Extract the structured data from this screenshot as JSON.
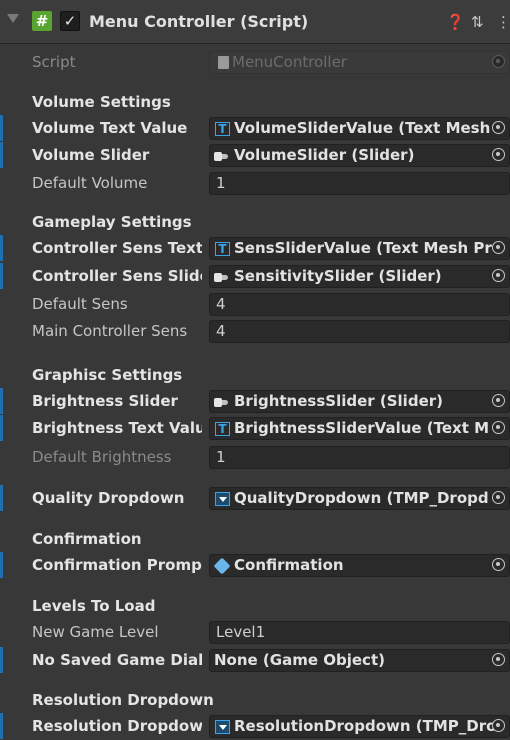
{
  "header": {
    "title": "Menu Controller (Script)",
    "script_icon": "#",
    "enabled_check": "✓",
    "help_icon": "❓",
    "preset_icon": "⇅",
    "menu_icon": "⋮"
  },
  "script": {
    "label": "Script",
    "value": "MenuController"
  },
  "volume": {
    "section": "Volume Settings",
    "text_value_label": "Volume Text Value",
    "text_value": "VolumeSliderValue (Text Mesh",
    "slider_label": "Volume Slider",
    "slider_value": "VolumeSlider (Slider)",
    "default_label": "Default Volume",
    "default_value": "1"
  },
  "gameplay": {
    "section": "Gameplay Settings",
    "sens_text_label": "Controller Sens Text '",
    "sens_text_value": "SensSliderValue (Text Mesh Pr",
    "sens_slider_label": "Controller Sens Slider",
    "sens_slider_value": "SensitivitySlider (Slider)",
    "default_sens_label": "Default Sens",
    "default_sens_value": "4",
    "main_sens_label": "Main Controller Sens",
    "main_sens_value": "4"
  },
  "graphics": {
    "section": "Graphisc Settings",
    "brightness_slider_label": "Brightness Slider",
    "brightness_slider_value": "BrightnessSlider (Slider)",
    "brightness_text_label": "Brightness Text Value",
    "brightness_text_value": "BrightnessSliderValue (Text M",
    "default_brightness_label": "Default Brightness",
    "default_brightness_value": "1"
  },
  "quality": {
    "label": "Quality Dropdown",
    "value": "QualityDropdown (TMP_Dropd"
  },
  "confirmation": {
    "section": "Confirmation",
    "prompt_label": "Confirmation Prompt",
    "prompt_value": "Confirmation"
  },
  "levels": {
    "section": "Levels To Load",
    "new_game_label": "New Game Level",
    "new_game_value": "Level1",
    "no_saved_label": "No Saved Game Dialog",
    "no_saved_value": "None (Game Object)"
  },
  "resolution": {
    "section": "Resolution Dropdown",
    "label": "Resolution Dropdown",
    "value": "ResolutionDropdown (TMP_Dro"
  },
  "colors": {
    "accent": "#3ea4e8",
    "script_badge": "#5aa532",
    "override_bar": "#1f6fb2",
    "background": "#383838"
  }
}
